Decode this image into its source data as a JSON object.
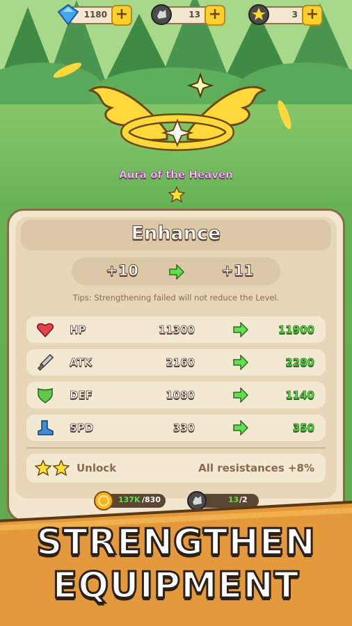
{
  "resources": {
    "gems": {
      "value": "1180",
      "icon": "gem-icon"
    },
    "stones": {
      "value": "13",
      "icon": "stone-icon"
    },
    "stars": {
      "value": "3",
      "icon": "star-coin-icon"
    },
    "plus_label": "+"
  },
  "item": {
    "name": "Aura of the Heaven",
    "stars": 1
  },
  "enhance": {
    "title": "Enhance",
    "level_from": "+10",
    "level_to": "+11",
    "tips": "Tips: Strengthening failed will not reduce the Level.",
    "stats": [
      {
        "name": "HP",
        "current": "11300",
        "next": "11900",
        "icon": "heart-icon"
      },
      {
        "name": "ATK",
        "current": "2160",
        "next": "2280",
        "icon": "sword-icon"
      },
      {
        "name": "DEF",
        "current": "1080",
        "next": "1140",
        "icon": "shield-icon"
      },
      {
        "name": "SPD",
        "current": "330",
        "next": "350",
        "icon": "boot-icon"
      }
    ],
    "unlock": {
      "label": "Unlock",
      "effect": "All resistances +8%",
      "stars": 2
    }
  },
  "cost": {
    "gold_have": "137K",
    "gold_need": "/830",
    "stone_have": "13",
    "stone_need": "/2"
  },
  "banner": {
    "line1": "STRENGTHEN",
    "line2": "EQUIPMENT"
  },
  "colors": {
    "accent_gold": "#ffcf2e",
    "stat_green": "#5fe14c",
    "panel": "#f2e6cf",
    "banner_orange": "#e49a3c"
  }
}
